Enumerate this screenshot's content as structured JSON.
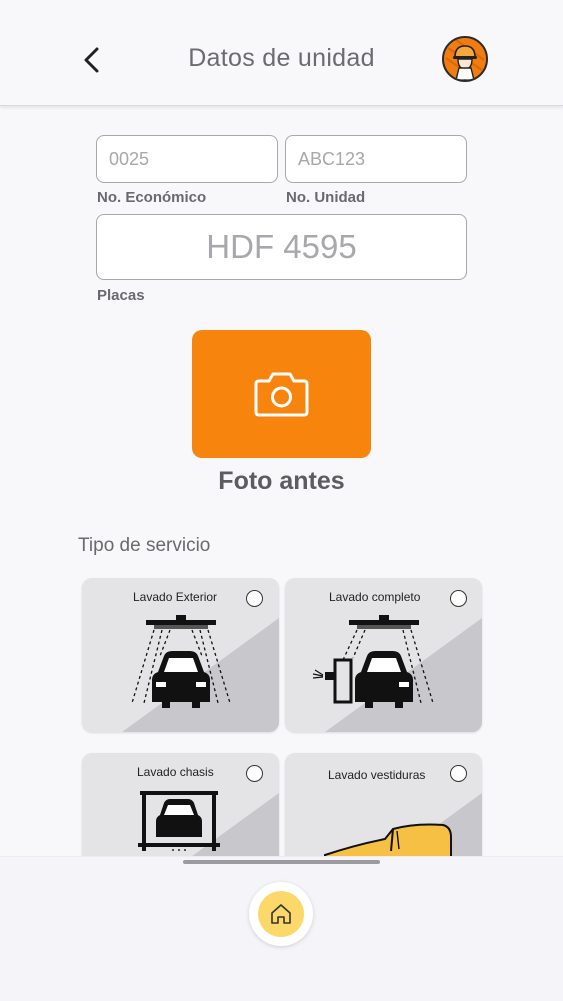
{
  "header": {
    "title": "Datos de unidad",
    "back_icon": "chevron-left-icon",
    "avatar_icon": "worker-helmet-avatar-icon"
  },
  "form": {
    "numero_economico": {
      "value": "",
      "placeholder": "0025",
      "label": "No. Económico"
    },
    "numero_unidad": {
      "value": "",
      "placeholder": "ABC123",
      "label": "No. Unidad"
    },
    "placas": {
      "value": "",
      "placeholder": "HDF 4595",
      "label": "Placas"
    }
  },
  "photo": {
    "label": "Foto antes",
    "icon": "camera-icon",
    "color": "#f6840d"
  },
  "services": {
    "title": "Tipo de servicio",
    "items": [
      {
        "label": "Lavado Exterior",
        "icon": "car-wash-exterior-icon"
      },
      {
        "label": "Lavado completo",
        "icon": "car-wash-complete-icon"
      },
      {
        "label": "Lavado chasis",
        "icon": "car-lift-chassis-icon"
      },
      {
        "label": "Lavado vestiduras",
        "icon": "car-seat-upholstery-icon"
      }
    ]
  },
  "bottom_nav": {
    "home_icon": "home-icon",
    "home_color": "#fcd86a"
  }
}
